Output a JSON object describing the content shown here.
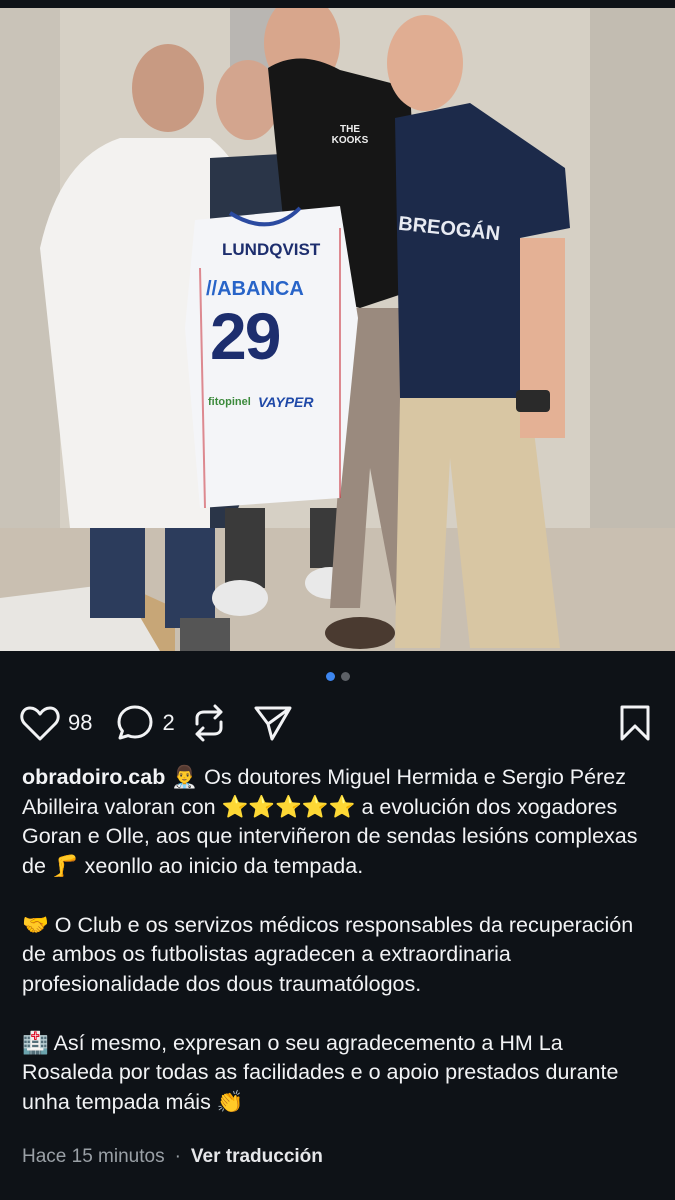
{
  "post": {
    "photo_alt": "",
    "jersey": {
      "name": "LUNDQVIST",
      "sponsor": "//ABANCA",
      "number": "29",
      "sponsor2": "VAYPER",
      "sponsor3": "fitopinel"
    },
    "tshirt_text": "THE KOOKS",
    "polo_text": "BREOGÁN",
    "carousel": {
      "count": 2,
      "active": 0
    },
    "likes": "98",
    "comments": "2",
    "username": "obradoiro.cab",
    "caption_p1_emoji": "👨‍⚕️",
    "caption_p1a": "Os doutores Miguel Hermida e Sergio Pérez Abilleira valoran con",
    "stars": "⭐⭐⭐⭐⭐",
    "caption_p1b": "a evolución dos xogadores Goran e Olle, aos que interviñeron de sendas lesións complexas de",
    "leg_emoji": "🦵",
    "caption_p1c": "xeonllo ao inicio da tempada.",
    "caption_p2_emoji": "🤝",
    "caption_p2": "O Club e os servizos médicos responsables da recuperación de ambos os futbolistas agradecen a extraordinaria profesionalidade dos dous traumatólogos.",
    "caption_p3_emoji": "🏥",
    "caption_p3": "Así mesmo, expresan o seu agradecemento a HM La Rosaleda por todas as facilidades e o apoio prestados durante unha tempada máis",
    "clap_emoji": "👏",
    "time": "Hace 15 minutos",
    "separator": "·",
    "translate": "Ver traducción"
  },
  "icons": {
    "like": "heart-icon",
    "comment": "comment-icon",
    "repost": "repost-icon",
    "share": "send-icon",
    "save": "bookmark-icon"
  }
}
